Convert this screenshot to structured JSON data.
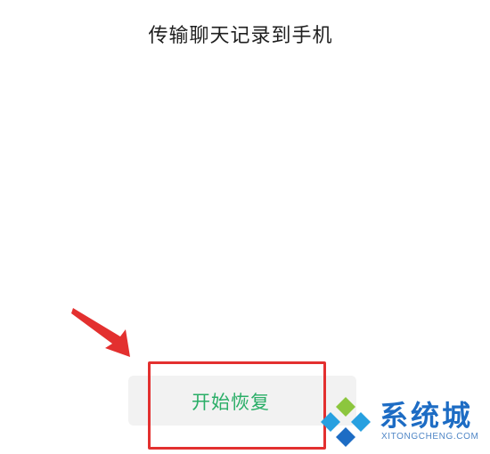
{
  "header": {
    "title": "传输聊天记录到手机"
  },
  "actions": {
    "restore_label": "开始恢复"
  },
  "watermark": {
    "title": "系统城",
    "subtitle": "XITONGCHENG.COM"
  },
  "colors": {
    "accent_green": "#2aae67",
    "annotation_red": "#e3302f",
    "watermark_blue": "#1d6cc4",
    "button_bg": "#f2f2f2"
  }
}
